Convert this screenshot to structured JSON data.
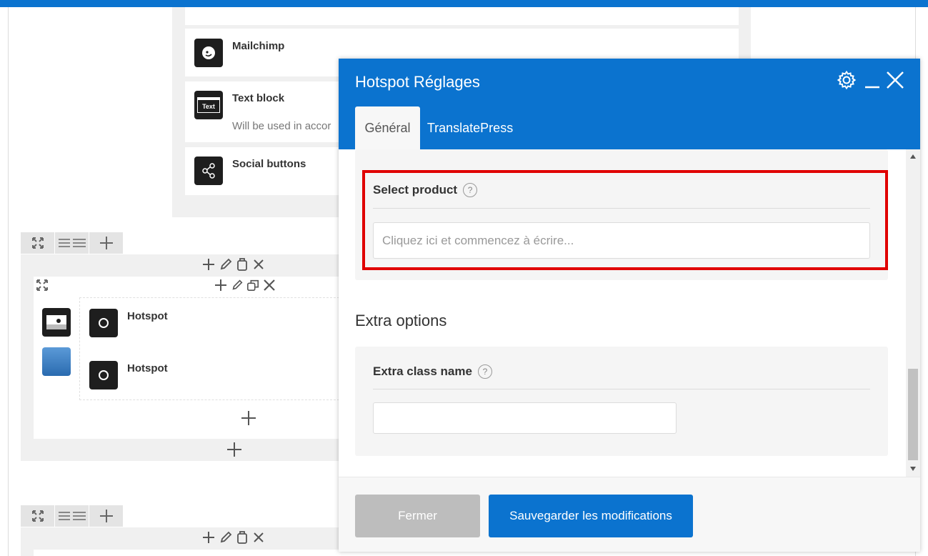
{
  "elements": [
    {
      "title": "Mailchimp",
      "description": "",
      "icon": "mailchimp-icon"
    },
    {
      "title": "Text block",
      "description": "Will be used in accor",
      "icon": "text-block-icon",
      "icon_text": "Text"
    },
    {
      "title": "Social buttons",
      "description": "",
      "icon": "share-icon"
    }
  ],
  "rows": [
    {
      "column_items": [
        {
          "label": "Hotspot"
        },
        {
          "label": "Hotspot"
        }
      ]
    }
  ],
  "modal": {
    "title": "Hotspot Réglages",
    "tabs": [
      {
        "label": "Général",
        "active": true
      },
      {
        "label": "TranslatePress",
        "active": false
      }
    ],
    "fields": {
      "select_product": {
        "label": "Select product",
        "help": "?",
        "placeholder": "Cliquez ici et commencez à écrire...",
        "value": ""
      },
      "extra_options_heading": "Extra options",
      "extra_class_name": {
        "label": "Extra class name",
        "help": "?",
        "value": ""
      }
    },
    "footer": {
      "close_label": "Fermer",
      "save_label": "Sauvegarder les modifications"
    }
  },
  "colors": {
    "accent": "#0b73cf",
    "highlight": "#e00000",
    "close_button": "#bdbdbd"
  }
}
